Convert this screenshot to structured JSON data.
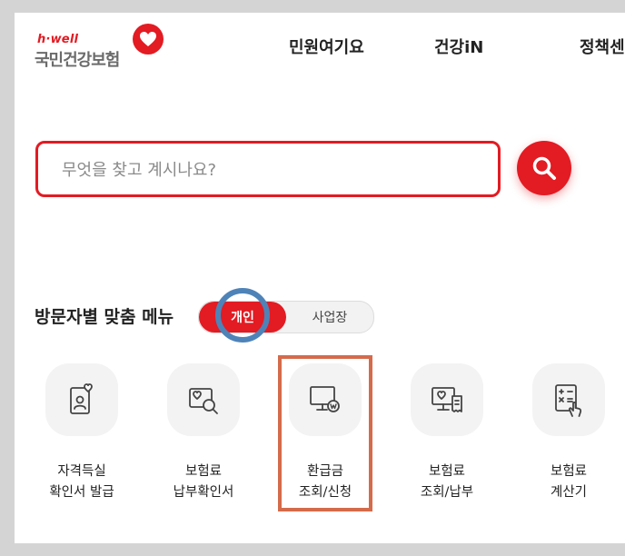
{
  "header": {
    "logo_sub": "h·well",
    "logo_main": "국민건강보험",
    "nav": [
      "민원여기요",
      "건강iN",
      "정책센"
    ]
  },
  "search": {
    "placeholder": "무엇을 찾고 계시나요?",
    "value": ""
  },
  "visitor_menu": {
    "title": "방문자별 맞춤 메뉴",
    "toggle_on": "개인",
    "toggle_off": "사업장"
  },
  "items": [
    {
      "line1": "자격득실",
      "line2": "확인서 발급",
      "icon": "certificate-heart-icon"
    },
    {
      "line1": "보험료",
      "line2": "납부확인서",
      "icon": "payment-search-icon"
    },
    {
      "line1": "환급금",
      "line2": "조회/신청",
      "icon": "refund-monitor-icon"
    },
    {
      "line1": "보험료",
      "line2": "조회/납부",
      "icon": "payment-receipt-icon"
    },
    {
      "line1": "보험료",
      "line2": "계산기",
      "icon": "calculator-icon"
    }
  ],
  "colors": {
    "brand_red": "#e31b23",
    "ring_blue": "#4e83b8",
    "highlight_orange": "#d46b4b"
  }
}
